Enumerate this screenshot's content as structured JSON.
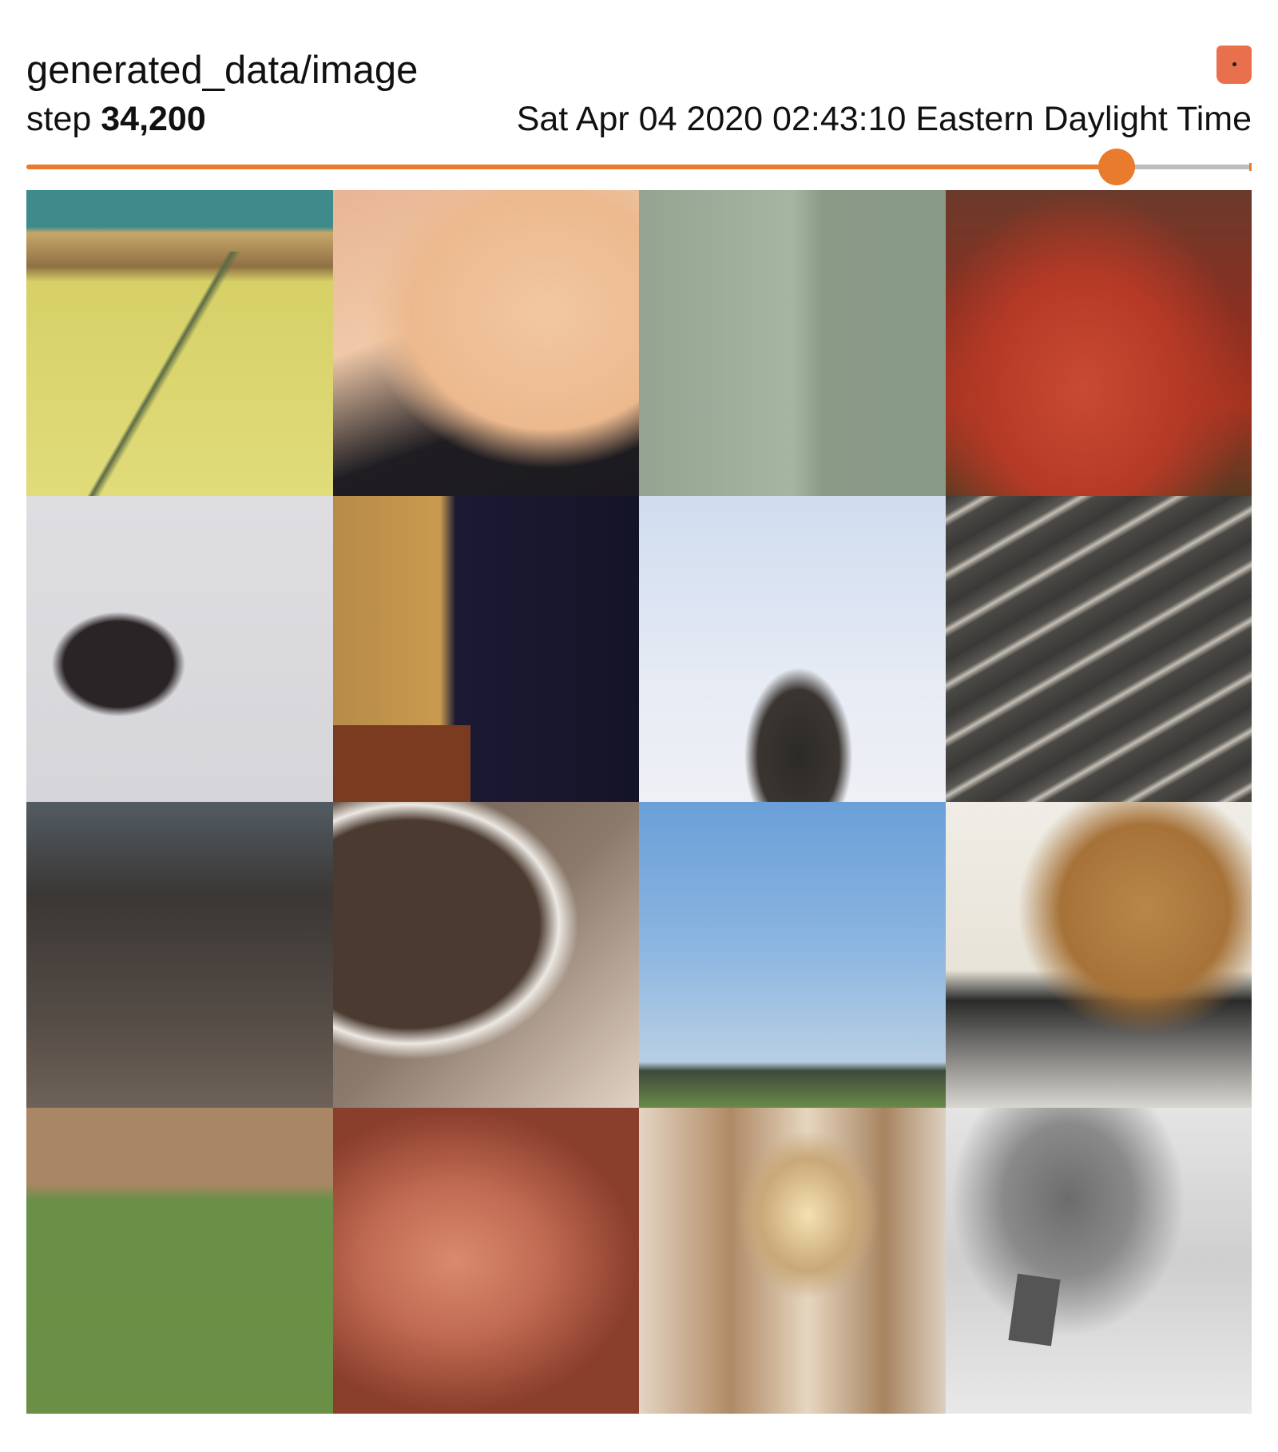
{
  "card": {
    "title": "generated_data/image",
    "step_label": "step",
    "step_value": "34,200",
    "wall_time": "Sat Apr 04 2020 02:43:10 Eastern Daylight Time",
    "expand_icon": "expand-icon"
  },
  "colors": {
    "accent": "#e97b2d",
    "expand_button": "#e9704d",
    "rail": "#bdbdbd"
  },
  "slider": {
    "position_fraction": 0.89
  },
  "image_grid": {
    "rows": 4,
    "columns": 4,
    "tile_count": 16
  }
}
